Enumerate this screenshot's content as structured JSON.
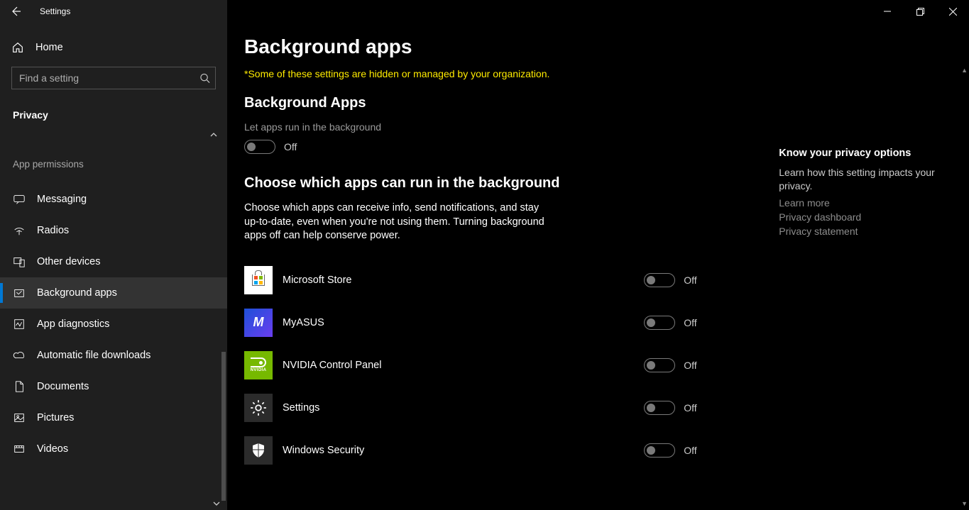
{
  "window": {
    "title": "Settings"
  },
  "sidebar": {
    "home": "Home",
    "search_placeholder": "Find a setting",
    "section": "Privacy",
    "group": "App permissions",
    "items": [
      {
        "label": "Messaging"
      },
      {
        "label": "Radios"
      },
      {
        "label": "Other devices"
      },
      {
        "label": "Background apps"
      },
      {
        "label": "App diagnostics"
      },
      {
        "label": "Automatic file downloads"
      },
      {
        "label": "Documents"
      },
      {
        "label": "Pictures"
      },
      {
        "label": "Videos"
      }
    ]
  },
  "page": {
    "title": "Background apps",
    "org_notice": "*Some of these settings are hidden or managed by your organization.",
    "section1_title": "Background Apps",
    "master_label": "Let apps run in the background",
    "master_state": "Off",
    "section2_title": "Choose which apps can run in the background",
    "section2_desc": "Choose which apps can receive info, send notifications, and stay up-to-date, even when you're not using them. Turning background apps off can help conserve power.",
    "apps": [
      {
        "name": "Microsoft Store",
        "state": "Off"
      },
      {
        "name": "MyASUS",
        "state": "Off"
      },
      {
        "name": "NVIDIA Control Panel",
        "state": "Off"
      },
      {
        "name": "Settings",
        "state": "Off"
      },
      {
        "name": "Windows Security",
        "state": "Off"
      }
    ]
  },
  "aside": {
    "title": "Know your privacy options",
    "desc": "Learn how this setting impacts your privacy.",
    "links": [
      "Learn more",
      "Privacy dashboard",
      "Privacy statement"
    ]
  }
}
